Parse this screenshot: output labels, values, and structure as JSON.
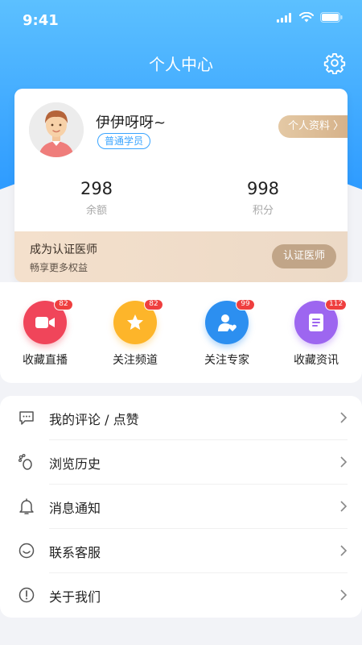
{
  "status_bar": {
    "time": "9:41"
  },
  "nav": {
    "title": "个人中心"
  },
  "profile": {
    "name": "伊伊呀呀~",
    "badge": "普通学员",
    "edit_button": "个人资料 〉",
    "stats": [
      {
        "value": "298",
        "label": "余额"
      },
      {
        "value": "998",
        "label": "积分"
      }
    ]
  },
  "certification": {
    "title": "成为认证医师",
    "subtitle": "畅享更多权益",
    "button": "认证医师"
  },
  "shortcuts": [
    {
      "label": "收藏直播",
      "count": "82",
      "color": "#f0455a",
      "icon": "video-camera-icon"
    },
    {
      "label": "关注频道",
      "count": "82",
      "color": "#fdb52a",
      "icon": "star-icon"
    },
    {
      "label": "关注专家",
      "count": "99",
      "color": "#2c8ff0",
      "icon": "expert-heart-icon"
    },
    {
      "label": "收藏资讯",
      "count": "112",
      "color": "#9d66f0",
      "icon": "document-icon"
    }
  ],
  "menu": [
    {
      "label": "我的评论 / 点赞",
      "icon": "comment-icon"
    },
    {
      "label": "浏览历史",
      "icon": "footprint-icon"
    },
    {
      "label": "消息通知",
      "icon": "bell-icon"
    },
    {
      "label": "联系客服",
      "icon": "customer-service-icon"
    },
    {
      "label": "关于我们",
      "icon": "info-icon"
    }
  ],
  "colors": {
    "primary": "#3ba6ff",
    "accent_gold": "#c1a588",
    "badge_red": "#ef3f3f"
  }
}
